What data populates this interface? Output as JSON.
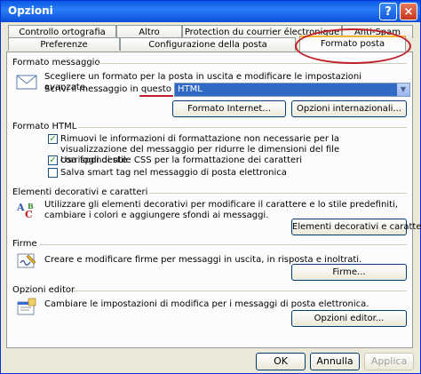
{
  "window": {
    "title": "Opzioni"
  },
  "titlebar_buttons": {
    "help": "?",
    "close": "×"
  },
  "tabs_row_back": [
    "Controllo ortografia",
    "Altro",
    "Protection du courrier électronique",
    "Anti-Spam"
  ],
  "tabs_row_front": [
    "Preferenze",
    "Configurazione della posta",
    "Formato posta"
  ],
  "sections": {
    "formato_messaggio": {
      "label": "Formato messaggio",
      "description": "Scegliere un formato per la posta in uscita e modificare le impostazioni avanzate.",
      "compose_label": "Scrivi il messaggio in questo formato:",
      "compose_value": "HTML",
      "btn_internet": "Formato Internet...",
      "btn_international": "Opzioni internazionali..."
    },
    "formato_html": {
      "label": "Formato HTML",
      "options": [
        {
          "text": "Rimuovi le informazioni di formattazione non necessarie per la visualizzazione del messaggio per ridurre le dimensioni del file corrispondente",
          "checked": true
        },
        {
          "text": "Usa fogli di stile CSS per la formattazione dei caratteri",
          "checked": true
        },
        {
          "text": "Salva smart tag nel messaggio di posta elettronica",
          "checked": false
        }
      ]
    },
    "elementi": {
      "label": "Elementi decorativi e caratteri",
      "description": "Utilizzare gli elementi decorativi per modificare il carattere e lo stile predefiniti, cambiare i colori e aggiungere sfondi ai messaggi.",
      "btn": "Elementi decorativi e caratteri..."
    },
    "firme": {
      "label": "Firme",
      "description": "Creare e modificare firme per messaggi in uscita, in risposta e inoltrati.",
      "btn": "Firme..."
    },
    "editor": {
      "label": "Opzioni editor",
      "description": "Cambiare le impostazioni di modifica per i messaggi di posta elettronica.",
      "btn": "Opzioni editor..."
    }
  },
  "dialog_buttons": {
    "ok": "OK",
    "cancel": "Annulla",
    "apply": "Applica"
  },
  "colors": {
    "titlebar": "#0a5ae6",
    "annotation": "#c0202a",
    "selection": "#316ac5"
  }
}
